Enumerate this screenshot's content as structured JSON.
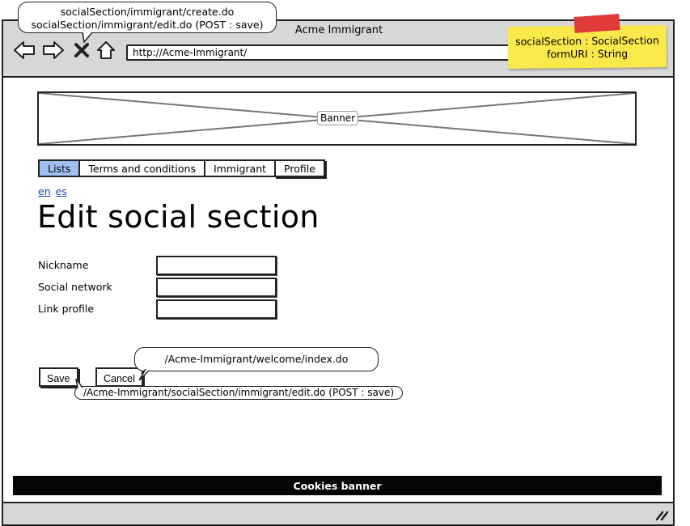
{
  "window": {
    "title": "Acme Immigrant"
  },
  "nav": {
    "url": "http://Acme-Immigrant/",
    "back_icon": "arrow-left-icon",
    "forward_icon": "arrow-right-icon",
    "stop_icon": "close-icon",
    "home_icon": "home-icon"
  },
  "annotations": {
    "top_line1": "socialSection/immigrant/create.do",
    "top_line2": "socialSection/immigrant/edit.do (POST : save)",
    "note_line1": "socialSection : SocialSection",
    "note_line2": "formURI : String",
    "cancel_target": "/Acme-Immigrant/welcome/index.do",
    "save_target": "/Acme-Immigrant/socialSection/immigrant/edit.do (POST : save)"
  },
  "banner": {
    "label": "Banner"
  },
  "menu": {
    "tabs": [
      {
        "label": "Lists"
      },
      {
        "label": "Terms and conditions"
      },
      {
        "label": "Immigrant"
      },
      {
        "label": "Profile"
      }
    ]
  },
  "languages": {
    "en": "en",
    "es": "es"
  },
  "page": {
    "title": "Edit social section"
  },
  "form": {
    "fields": [
      {
        "label": "Nickname",
        "value": ""
      },
      {
        "label": "Social network",
        "value": ""
      },
      {
        "label": "Link profile",
        "value": ""
      }
    ],
    "save_label": "Save",
    "cancel_label": "Cancel"
  },
  "footer": {
    "cookies": "Cookies banner"
  },
  "colors": {
    "active_tab": "#9fbff0",
    "note": "#fbe84a",
    "tape": "#e03a3a",
    "link": "#1a47a8",
    "footer": "#050505"
  }
}
